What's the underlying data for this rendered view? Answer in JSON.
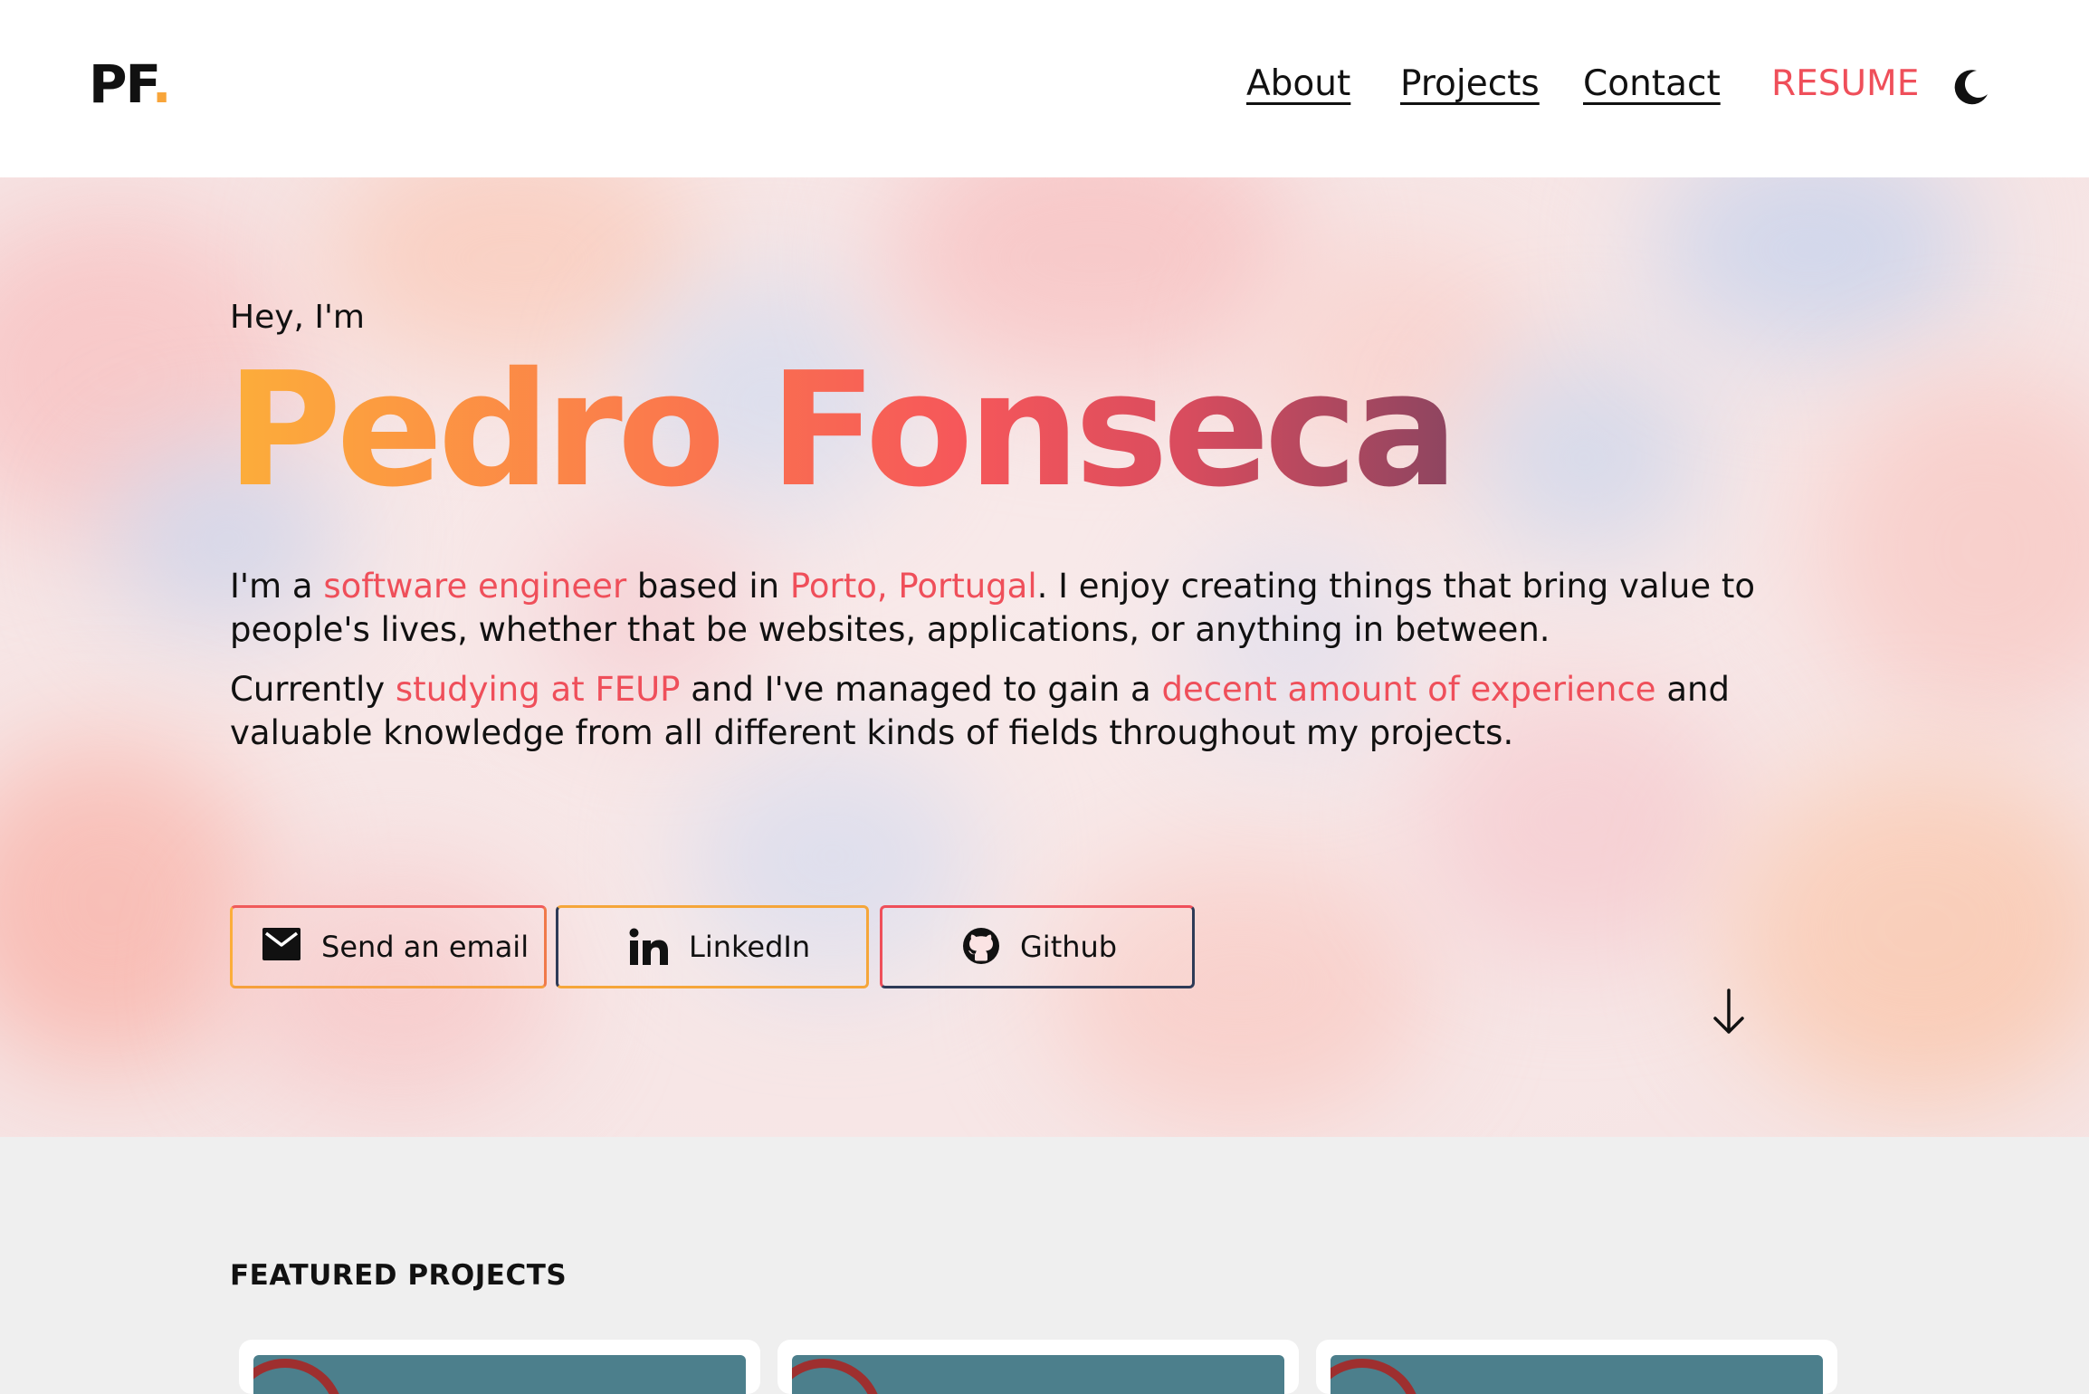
{
  "header": {
    "logo_text": "PF",
    "logo_dot": ".",
    "nav": {
      "about": "About",
      "projects": "Projects",
      "contact": "Contact",
      "resume": "RESUME"
    },
    "theme_toggle_icon": "moon-icon"
  },
  "hero": {
    "greeting": "Hey, I'm",
    "name": "Pedro Fonseca",
    "intro1": {
      "t1": "I'm a ",
      "h1": "software engineer",
      "t2": " based in ",
      "h2": "Porto, Portugal",
      "t3": ". I enjoy creating things that bring value to people's lives, whether that be websites, applications, or anything in between."
    },
    "intro2": {
      "t1": "Currently ",
      "h1": "studying at FEUP",
      "t2": " and I've managed to gain a ",
      "h2": "decent amount of experience",
      "t3": " and valuable knowledge from all different kinds of fields throughout my projects."
    },
    "buttons": {
      "email": {
        "label": "Send an email",
        "icon": "mail-icon"
      },
      "linkedin": {
        "label": "LinkedIn",
        "icon": "linkedin-icon"
      },
      "github": {
        "label": "Github",
        "icon": "github-icon"
      }
    },
    "scroll_icon": "arrow-down-icon"
  },
  "featured": {
    "title": "FEATURED PROJECTS",
    "cards": [
      "",
      "",
      ""
    ]
  },
  "colors": {
    "accent": "#ef4f5a",
    "logo_dot": "#f8a53a",
    "gradient_start": "#fcae3a",
    "gradient_end": "#8d4560",
    "card_thumb": "#4c7f8c",
    "page_bg": "#efefef"
  }
}
